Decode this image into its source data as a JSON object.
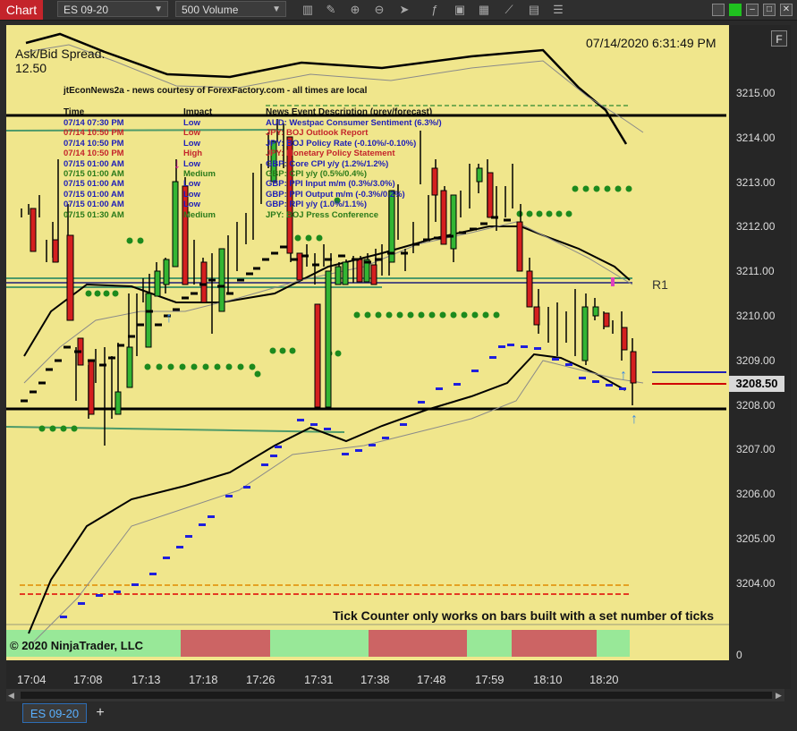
{
  "toolbar": {
    "title": "Chart",
    "instrument": "ES 09-20",
    "period": "500 Volume"
  },
  "chart": {
    "timestamp": "07/14/2020 6:31:49 PM",
    "spread_label": "Ask/Bid Spread:",
    "spread_value": "12.50",
    "news_header": "jtEconNews2a - news courtesy of ForexFactory.com - all times are local",
    "news_columns": [
      "Time",
      "Impact",
      "News Event Description (prev/forecast)"
    ],
    "news": [
      {
        "time": "07/14 07:30 PM",
        "impact": "Low",
        "desc": "AUD: Westpac Consumer Sentiment (6.3%/)",
        "color": "#1f1fb8"
      },
      {
        "time": "07/14 10:50 PM",
        "impact": "Low",
        "desc": "JPY: BOJ Outlook Report",
        "color": "#c4242b"
      },
      {
        "time": "07/14 10:50 PM",
        "impact": "Low",
        "desc": "JPY: BOJ Policy Rate (-0.10%/-0.10%)",
        "color": "#1f1fb8"
      },
      {
        "time": "07/14 10:50 PM",
        "impact": "High",
        "desc": "JPY: Monetary Policy Statement",
        "color": "#c4242b"
      },
      {
        "time": "07/15 01:00 AM",
        "impact": "Low",
        "desc": "GBP: Core CPI y/y (1.2%/1.2%)",
        "color": "#1f1fb8"
      },
      {
        "time": "07/15 01:00 AM",
        "impact": "Medium",
        "desc": "GBP: CPI y/y (0.5%/0.4%)",
        "color": "#2a7a1a"
      },
      {
        "time": "07/15 01:00 AM",
        "impact": "Low",
        "desc": "GBP: PPI Input m/m (0.3%/3.0%)",
        "color": "#1f1fb8"
      },
      {
        "time": "07/15 01:00 AM",
        "impact": "Low",
        "desc": "GBP: PPI Output m/m (-0.3%/0.2%)",
        "color": "#1f1fb8"
      },
      {
        "time": "07/15 01:00 AM",
        "impact": "Low",
        "desc": "GBP: RPI y/y (1.0%/1.1%)",
        "color": "#1f1fb8"
      },
      {
        "time": "07/15 01:30 AM",
        "impact": "Medium",
        "desc": "JPY: BOJ Press Conference",
        "color": "#2a7a1a"
      }
    ],
    "pivot_label": "R1",
    "tick_note": "Tick Counter only works on bars built with a set number of ticks",
    "copyright": "© 2020 NinjaTrader, LLC",
    "price_labels": [
      "3215.00",
      "3214.00",
      "3213.00",
      "3212.00",
      "3211.00",
      "3210.00",
      "3209.00",
      "3208.00",
      "3207.00",
      "3206.00",
      "3205.00",
      "3204.00"
    ],
    "current_price": "3208.50",
    "indicator_zero": "0",
    "time_labels": [
      "17:04",
      "17:08",
      "17:13",
      "17:18",
      "17:26",
      "17:31",
      "17:38",
      "17:48",
      "17:59",
      "18:10",
      "18:20"
    ]
  },
  "tabs": [
    {
      "label": "ES 09-20"
    }
  ],
  "add_tab": "+",
  "properties_button": "F"
}
